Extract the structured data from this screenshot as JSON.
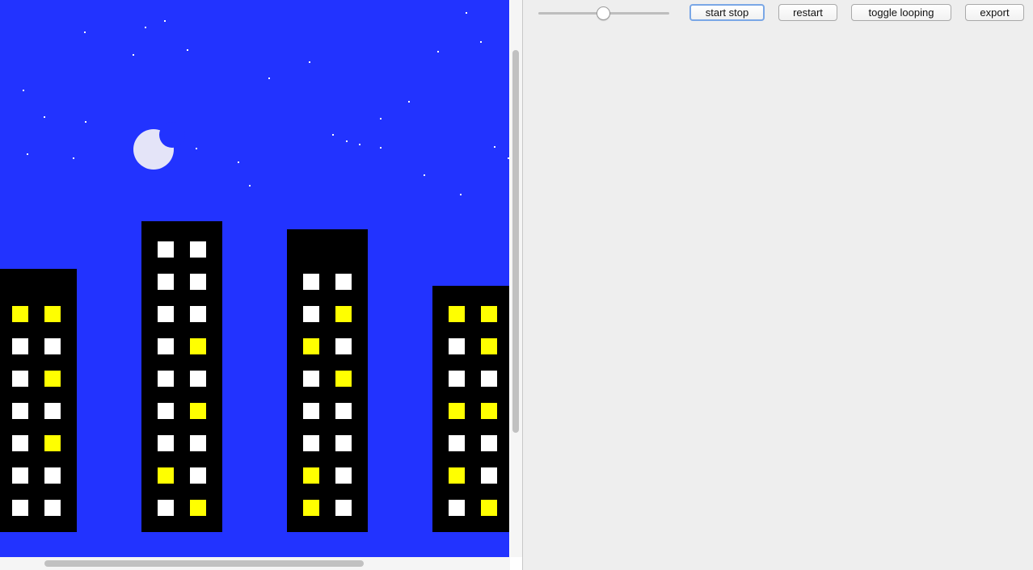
{
  "scene": {
    "sky_color": "#2233ff",
    "building_color": "#000000",
    "lit_window_color": "#ffff00",
    "unlit_window_color": "#ffffff",
    "moon_color": "#e4e4f8",
    "star_color": "#ffffff"
  },
  "controls": {
    "speed_slider_value": 0.49,
    "start_stop_label": "start stop",
    "restart_label": "restart",
    "toggle_looping_label": "toggle looping",
    "export_label": "export"
  }
}
